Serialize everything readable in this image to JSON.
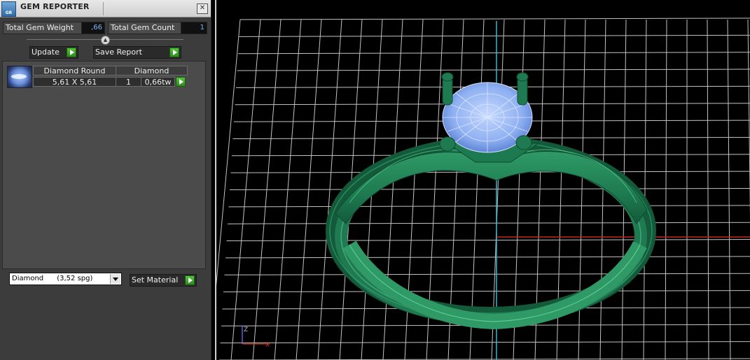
{
  "window": {
    "title": "GEM REPORTER",
    "icon_label": "GR",
    "close_symbol": "✕"
  },
  "stats": {
    "total_weight_label": "Total Gem Weight",
    "total_weight_value": ",66",
    "total_count_label": "Total Gem Count",
    "total_count_value": "1"
  },
  "actions": {
    "update_label": "Update",
    "save_report_label": "Save Report"
  },
  "gem_list": {
    "headers": [
      "Diamond Round",
      "Diamond"
    ],
    "rows": [
      {
        "size": "5,61 X 5,61",
        "count": "1",
        "weight": "0,66tw"
      }
    ]
  },
  "material": {
    "selected": "Diamond      (3,52 spg)",
    "set_label": "Set Material"
  },
  "viewport": {
    "axis_z_label": "Z",
    "axis_x_label": "X",
    "colors": {
      "grid": "#d8d8d8",
      "ring": "#1f7a52",
      "gem": "#9fbdf7",
      "axis_y": "#3fb6c9",
      "axis_x": "#c0291f"
    }
  }
}
